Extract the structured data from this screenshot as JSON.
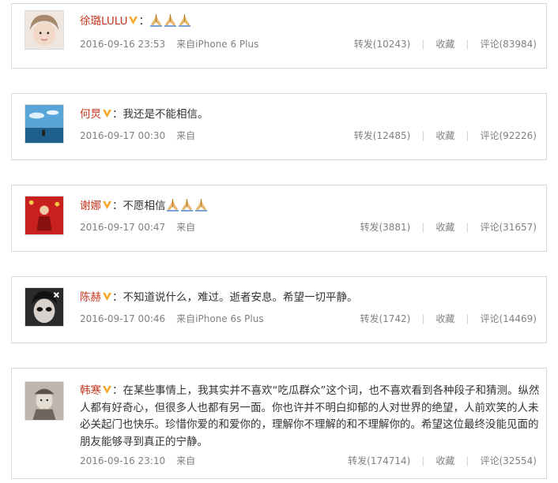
{
  "posts": [
    {
      "name": "徐璐LULU",
      "text": "：",
      "emoji_count": 3,
      "time": "2016-09-16 23:53",
      "source": "来自iPhone 6 Plus",
      "repost": "转发(10243)",
      "fav": "收藏",
      "comment": "评论(83984)"
    },
    {
      "name": "何炅",
      "text": "：我还是不能相信。",
      "emoji_count": 0,
      "time": "2016-09-17 00:30",
      "source": "来自",
      "repost": "转发(12485)",
      "fav": "收藏",
      "comment": "评论(92226)"
    },
    {
      "name": "谢娜",
      "text": "：不愿相信",
      "emoji_count": 3,
      "time": "2016-09-17 00:47",
      "source": "来自",
      "repost": "转发(3881)",
      "fav": "收藏",
      "comment": "评论(31657)"
    },
    {
      "name": "陈赫",
      "text": "：不知道说什么，难过。逝者安息。希望一切平静。",
      "emoji_count": 0,
      "time": "2016-09-17 00:46",
      "source": "来自iPhone 6s Plus",
      "repost": "转发(1742)",
      "fav": "收藏",
      "comment": "评论(14469)"
    },
    {
      "name": "韩寒",
      "text": "：在某些事情上，我其实并不喜欢“吃瓜群众”这个词，也不喜欢看到各种段子和猜测。纵然人都有好奇心，但很多人也都有另一面。你也许并不明白抑郁的人对世界的绝望，人前欢笑的人未必关起门也快乐。珍惜你爱的和爱你的，理解你不理解的和不理解你的。希望这位最终没能见面的朋友能够寻到真正的宁静。",
      "emoji_count": 0,
      "time": "2016-09-16 23:10",
      "source": "来自",
      "repost": "转发(174714)",
      "fav": "收藏",
      "comment": "评论(32554)"
    }
  ],
  "colors": {
    "name": "#c4361f",
    "meta": "#808080",
    "border": "#d9d9d9",
    "vbadge": "#f5a623"
  },
  "icons": {
    "verified": "verified-v-icon",
    "emoji": "praying-hands-icon"
  }
}
